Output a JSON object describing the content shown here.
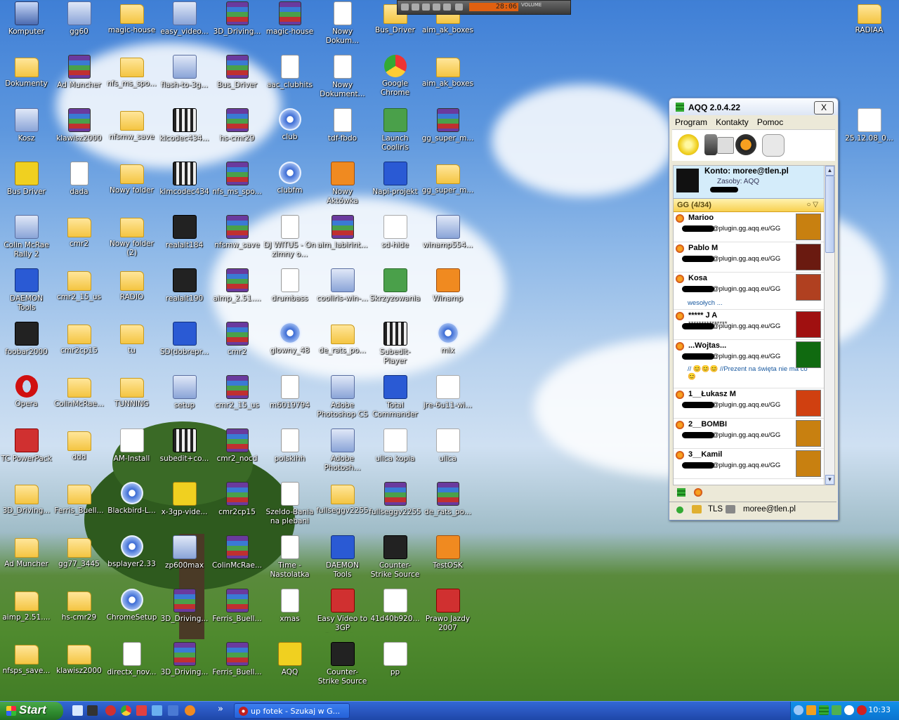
{
  "desktop_icons": [
    {
      "label": "Komputer",
      "type": "pc"
    },
    {
      "label": "gg60",
      "type": "app"
    },
    {
      "label": "magic-house",
      "type": "folder"
    },
    {
      "label": "easy_video...",
      "type": "app"
    },
    {
      "label": "3D_Driving...",
      "type": "rar"
    },
    {
      "label": "magic-house",
      "type": "rar"
    },
    {
      "label": "Nowy Dokum...",
      "type": "doc"
    },
    {
      "label": "Bus_Driver",
      "type": "folder"
    },
    {
      "label": "aim_ak_boxes",
      "type": "folder"
    },
    {
      "label": "RADIAA",
      "type": "folder"
    },
    {
      "label": "Dokumenty",
      "type": "folder"
    },
    {
      "label": "Ad Muncher",
      "type": "rar"
    },
    {
      "label": "nfs_ms_spo...",
      "type": "folder"
    },
    {
      "label": "flash-to-3g...",
      "type": "app"
    },
    {
      "label": "Bus_Driver",
      "type": "rar"
    },
    {
      "label": "aac_clubhits",
      "type": "doc"
    },
    {
      "label": "Nowy Dokument...",
      "type": "doc"
    },
    {
      "label": "Google Chrome",
      "type": "chrome"
    },
    {
      "label": "aim_ak_boxes",
      "type": "folder"
    },
    {
      "label": "Kosz",
      "type": "app"
    },
    {
      "label": "klawisz2000",
      "type": "rar"
    },
    {
      "label": "nfsmw_save",
      "type": "folder"
    },
    {
      "label": "klcodec434...",
      "type": "film"
    },
    {
      "label": "hs-cmr29",
      "type": "rar"
    },
    {
      "label": "club",
      "type": "media"
    },
    {
      "label": "tdf-fbdo",
      "type": "doc"
    },
    {
      "label": "Launch Cooliris",
      "type": "green"
    },
    {
      "label": "gg_super_m...",
      "type": "rar"
    },
    {
      "label": "25.12.08_0...",
      "type": "white"
    },
    {
      "label": "Bus Driver",
      "type": "yellow"
    },
    {
      "label": "dada",
      "type": "doc"
    },
    {
      "label": "Nowy folder",
      "type": "folder"
    },
    {
      "label": "klmcodec434",
      "type": "film"
    },
    {
      "label": "nfs_ms_spo...",
      "type": "rar"
    },
    {
      "label": "clubfm",
      "type": "media"
    },
    {
      "label": "Nowy Aktówka",
      "type": "orange"
    },
    {
      "label": "Napi-projekt",
      "type": "blue"
    },
    {
      "label": "gg_super_m...",
      "type": "folder"
    },
    {
      "label": "Colin McRae Rally 2",
      "type": "app"
    },
    {
      "label": "cmr2",
      "type": "folder"
    },
    {
      "label": "Nowy folder (2)",
      "type": "folder"
    },
    {
      "label": "realalt184",
      "type": "dark"
    },
    {
      "label": "nfsmw_save",
      "type": "rar"
    },
    {
      "label": "DJ WITUS - On zimny o...",
      "type": "doc"
    },
    {
      "label": "aim_labirint...",
      "type": "rar"
    },
    {
      "label": "sd-hide",
      "type": "white"
    },
    {
      "label": "winamp554...",
      "type": "app"
    },
    {
      "label": "DAEMON Tools",
      "type": "blue"
    },
    {
      "label": "cmr2_15_us",
      "type": "folder"
    },
    {
      "label": "RADIO",
      "type": "folder"
    },
    {
      "label": "realalt190",
      "type": "dark"
    },
    {
      "label": "aimp_2.51....",
      "type": "rar"
    },
    {
      "label": "drumbass",
      "type": "doc"
    },
    {
      "label": "cooliris-win-...",
      "type": "app"
    },
    {
      "label": "Skrzyzowania",
      "type": "green"
    },
    {
      "label": "Winamp",
      "type": "orange"
    },
    {
      "label": "foobar2000",
      "type": "dark"
    },
    {
      "label": "cmr2cp15",
      "type": "folder"
    },
    {
      "label": "tu",
      "type": "folder"
    },
    {
      "label": "SD(dobrepr...",
      "type": "blue"
    },
    {
      "label": "cmr2",
      "type": "rar"
    },
    {
      "label": "glowny_48",
      "type": "media"
    },
    {
      "label": "de_rats_po...",
      "type": "folder"
    },
    {
      "label": "Subedit-Player",
      "type": "film"
    },
    {
      "label": "mix",
      "type": "media"
    },
    {
      "label": "Opera",
      "type": "opera"
    },
    {
      "label": "ColinMcRae...",
      "type": "folder"
    },
    {
      "label": "TUNNING",
      "type": "folder"
    },
    {
      "label": "setup",
      "type": "app"
    },
    {
      "label": "cmr2_15_us",
      "type": "rar"
    },
    {
      "label": "m6019794",
      "type": "doc"
    },
    {
      "label": "Adobe Photoshop CS",
      "type": "app"
    },
    {
      "label": "Total Commander",
      "type": "blue"
    },
    {
      "label": "jre-6u11-wi...",
      "type": "white"
    },
    {
      "label": "TC PowerPack",
      "type": "red"
    },
    {
      "label": "ddd",
      "type": "folder"
    },
    {
      "label": "AM-Install",
      "type": "white"
    },
    {
      "label": "subedit+co...",
      "type": "film"
    },
    {
      "label": "cmr2_nocd",
      "type": "rar"
    },
    {
      "label": "polskihh",
      "type": "doc"
    },
    {
      "label": "Adobe Photosh...",
      "type": "app"
    },
    {
      "label": "ulica kopia",
      "type": "white"
    },
    {
      "label": "ulica",
      "type": "white"
    },
    {
      "label": "3D_Driving...",
      "type": "folder"
    },
    {
      "label": "Ferris_Buell...",
      "type": "folder"
    },
    {
      "label": "Blackbird-L...",
      "type": "media"
    },
    {
      "label": "x-3gp-vide...",
      "type": "yellow"
    },
    {
      "label": "cmr2cp15",
      "type": "rar"
    },
    {
      "label": "Szeldo-Bania na plebani",
      "type": "doc"
    },
    {
      "label": "fullseggv2255",
      "type": "folder"
    },
    {
      "label": "fullseggv2255",
      "type": "rar"
    },
    {
      "label": "de_rats_po...",
      "type": "rar"
    },
    {
      "label": "Ad Muncher",
      "type": "folder"
    },
    {
      "label": "gg77_3445",
      "type": "folder"
    },
    {
      "label": "bsplayer2.33",
      "type": "media"
    },
    {
      "label": "zp600max",
      "type": "app"
    },
    {
      "label": "ColinMcRae...",
      "type": "rar"
    },
    {
      "label": "Time - Nastolatka",
      "type": "doc"
    },
    {
      "label": "DAEMON Tools",
      "type": "blue"
    },
    {
      "label": "Counter-Strike Source",
      "type": "dark"
    },
    {
      "label": "TestOSK",
      "type": "orange"
    },
    {
      "label": "aimp_2.51....",
      "type": "folder"
    },
    {
      "label": "hs-cmr29",
      "type": "folder"
    },
    {
      "label": "ChromeSetup",
      "type": "media"
    },
    {
      "label": "3D_Driving...",
      "type": "rar"
    },
    {
      "label": "Ferris_Buell...",
      "type": "rar"
    },
    {
      "label": "xmas",
      "type": "doc"
    },
    {
      "label": "Easy Video to 3GP Converter",
      "type": "red"
    },
    {
      "label": "41d40b920...",
      "type": "white"
    },
    {
      "label": "Prawo Jazdy 2007",
      "type": "red"
    },
    {
      "label": "nfsps_save...",
      "type": "folder"
    },
    {
      "label": "klawisz2000",
      "type": "folder"
    },
    {
      "label": "directx_nov...",
      "type": "doc"
    },
    {
      "label": "3D_Driving...",
      "type": "rar"
    },
    {
      "label": "Ferris_Buell...",
      "type": "rar"
    },
    {
      "label": "AQQ",
      "type": "yellow"
    },
    {
      "label": "Counter-Strike Source (2)",
      "type": "dark"
    },
    {
      "label": "pp",
      "type": "white"
    }
  ],
  "media_player": {
    "time": "28:06",
    "volume_label": "VOLUME"
  },
  "aqq": {
    "title": "AQQ 2.0.4.22",
    "close_label": "X",
    "menu": [
      "Program",
      "Kontakty",
      "Pomoc"
    ],
    "account": {
      "line1": "Konto: moree@tlen.pl",
      "line2": "Zasoby: AQQ"
    },
    "group": {
      "label": "GG (4/34)",
      "controls": "○ ▽"
    },
    "contacts": [
      {
        "name": "Marioo",
        "jid": "@plugin.gg.aqq.eu/GG",
        "desc": "",
        "avatar": "#c88010"
      },
      {
        "name": "Pablo M",
        "jid": "@plugin.gg.aqq.eu/GG",
        "desc": "",
        "avatar": "#6a1a10"
      },
      {
        "name": "Kosa",
        "jid": "@plugin.gg.aqq.eu/GG",
        "desc": "wesołych ...",
        "avatar": "#b04020"
      },
      {
        "name": "***** J A",
        "sub": "***************",
        "jid": "@plugin.gg.aqq.eu/GG",
        "desc": "",
        "avatar": "#a01010"
      },
      {
        "name": "...Wojtas...",
        "jid": "@plugin.gg.aqq.eu/GG",
        "desc": "// 😊😊😊 //Prezent na święta nie ma co 😊",
        "avatar": "#106a10"
      },
      {
        "name": "1__Łukasz M",
        "jid": "@plugin.gg.aqq.eu/GG",
        "desc": "",
        "avatar": "#d04010"
      },
      {
        "name": "2__BOMBI",
        "jid": "@plugin.gg.aqq.eu/GG",
        "desc": "",
        "avatar": "#c88010"
      },
      {
        "name": "3__Kamil",
        "jid": "@plugin.gg.aqq.eu/GG",
        "desc": "",
        "avatar": "#c88010"
      }
    ],
    "status_bar": {
      "tls": "TLS",
      "account": "moree@tlen.pl"
    }
  },
  "taskbar": {
    "start_label": "Start",
    "task_label": "up fotek - Szukaj w G...",
    "overflow": "»",
    "clock": "10:33"
  }
}
